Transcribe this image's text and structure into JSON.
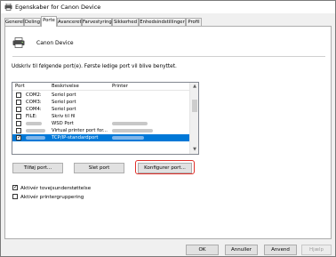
{
  "window": {
    "title": "Egenskaber for Canon Device"
  },
  "tabs": [
    {
      "label": "Generelt",
      "active": false
    },
    {
      "label": "Deling",
      "active": false
    },
    {
      "label": "Porte",
      "active": true
    },
    {
      "label": "Avanceret",
      "active": false
    },
    {
      "label": "Farvestyring",
      "active": false
    },
    {
      "label": "Sikkerhed",
      "active": false
    },
    {
      "label": "Enhedsindstillinger",
      "active": false
    },
    {
      "label": "Profil",
      "active": false
    }
  ],
  "device": {
    "name": "Canon Device",
    "icon": "printer-icon"
  },
  "instruction": "Udskriv til følgende port(e). Første ledige port vil blive benyttet.",
  "port_list": {
    "headers": {
      "port": "Port",
      "description": "Beskrivelse",
      "printer": "Printer"
    },
    "rows": [
      {
        "port": "COM2:",
        "description": "Seriel port",
        "checked": false,
        "selected": false
      },
      {
        "port": "COM3:",
        "description": "Seriel port",
        "checked": false,
        "selected": false
      },
      {
        "port": "COM4:",
        "description": "Seriel port",
        "checked": false,
        "selected": false
      },
      {
        "port": "FILE:",
        "description": "Skriv til fil",
        "checked": false,
        "selected": false
      },
      {
        "port": "",
        "description": "WSD Port",
        "checked": false,
        "selected": false
      },
      {
        "port": "",
        "description": "Virtual printer port for...",
        "checked": false,
        "selected": false
      },
      {
        "port": "",
        "description": "TCP/IP-standardport",
        "checked": true,
        "selected": true
      }
    ]
  },
  "buttons": {
    "add_port": "Tilføj port...",
    "delete_port": "Slet port",
    "configure_port": "Konfigurer port..."
  },
  "options": {
    "bidirectional": {
      "label": "Aktivér tovejsunderstøttelse",
      "checked": true
    },
    "pooling": {
      "label": "Aktivér printergruppering",
      "checked": false
    }
  },
  "footer": {
    "ok": "OK",
    "cancel": "Annuller",
    "apply": "Anvend",
    "help": "Hjælp"
  },
  "colors": {
    "selection": "#0078d7",
    "highlight": "#e0302a"
  }
}
